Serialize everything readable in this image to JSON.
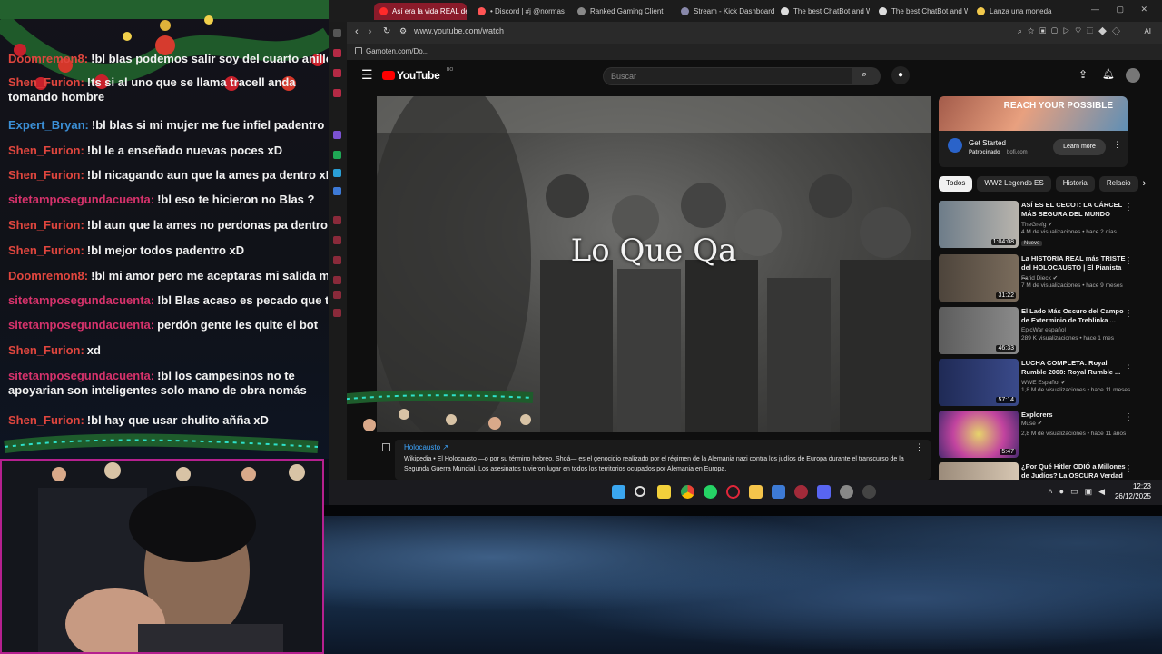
{
  "chat": {
    "messages": [
      {
        "user": "Doomremon8:",
        "user_color": "#e0463e",
        "text": "!bl blas podemos salir soy del cuarto anillo",
        "visible_user": "Doomremon8:"
      },
      {
        "user": "Shen_Furion:",
        "user_color": "#e0463e",
        "text": "!ts si al uno que se llama tracell anda tomando hombre"
      },
      {
        "user": "Expert_Bryan:",
        "user_color": "#3b8fd6",
        "text": "!bl blas si mi mujer me fue infiel padentro non"
      },
      {
        "user": "Shen_Furion:",
        "user_color": "#e0463e",
        "text": "!bl le a enseñado nuevas poces xD"
      },
      {
        "user": "Shen_Furion:",
        "user_color": "#e0463e",
        "text": "!bl nicagando aun que la ames pa dentro xD"
      },
      {
        "user": "sitetamposegundacuenta:",
        "user_color": "#d6326b",
        "text": "!bl eso te hicieron no Blas ?"
      },
      {
        "user": "Shen_Furion:",
        "user_color": "#e0463e",
        "text": "!bl aun que la ames no perdonas pa dentro xD"
      },
      {
        "user": "Shen_Furion:",
        "user_color": "#e0463e",
        "text": "!bl mejor todos padentro xD"
      },
      {
        "user": "Doomremon8:",
        "user_color": "#e0463e",
        "text": "!bl mi amor pero me aceptaras mi salida mi am"
      },
      {
        "user": "sitetamposegundacuenta:",
        "user_color": "#d6326b",
        "text": "!bl Blas acaso es pecado que te ar"
      },
      {
        "user": "sitetamposegundacuenta:",
        "user_color": "#d6326b",
        "text": "perdón gente les quite el bot"
      },
      {
        "user": "Shen_Furion:",
        "user_color": "#e0463e",
        "text": "xd"
      },
      {
        "user": "sitetamposegundacuenta:",
        "user_color": "#d6326b",
        "text": "!bl los campesinos no te apoyarian son inteligentes solo mano de obra nomás"
      },
      {
        "user": "Shen_Furion:",
        "user_color": "#e0463e",
        "text": "!bl hay que usar chulito añña xD"
      }
    ]
  },
  "browser": {
    "tabs": [
      {
        "label": "Así era la vida REAL de lo",
        "active": true,
        "color": "#ff2a2a"
      },
      {
        "label": "• Discord | #j @normas-",
        "color": "#ff5555"
      },
      {
        "label": "Ranked Gaming Client",
        "color": "#888888"
      },
      {
        "label": "Stream - Kick Dashboard",
        "color": "#8888aa"
      },
      {
        "label": "The best ChatBot and W",
        "color": "#dddddd"
      },
      {
        "label": "The best ChatBot and W",
        "color": "#dddddd"
      },
      {
        "label": "Lanza una moneda",
        "color": "#f2c94c"
      }
    ],
    "url": "www.youtube.com/watch",
    "bookmark": "Gamoten.com/Do...",
    "extension_label": "AI"
  },
  "youtube": {
    "logo": "YouTube",
    "logo_sup": "BO",
    "search_placeholder": "Buscar",
    "video_overlay_text": "Lo Que Qa",
    "wiki": {
      "title": "Holocausto ↗",
      "text": "Wikipedia • El Holocausto —o por su término hebreo, Shoá— es el genocidio realizado por el régimen de la Alemania nazi contra los judíos de Europa durante el transcurso de la Segunda Guerra Mundial. Los asesinatos tuvieron lugar en todos los territorios ocupados por Alemania en Europa."
    },
    "ad": {
      "banner": "REACH YOUR POSSIBLE",
      "title": "Get Started",
      "sponsor": "Patrocinado",
      "domain": "bofi.com",
      "cta": "Learn more"
    },
    "chips": [
      "Todos",
      "WW2 Legends ES",
      "Historia",
      "Relacio"
    ],
    "recommendations": [
      {
        "title": "ASÍ ES EL CECOT: LA CÁRCEL MÁS SEGURA DEL MUNDO",
        "channel": "TheGrefg ✔",
        "meta": "4 M de visualizaciones • hace 2 días",
        "badge": "Nuevo",
        "duration": "1:04:08",
        "thumb": "#7a8c9a"
      },
      {
        "title": "La HISTORIA REAL más TRISTE del HOLOCAUSTO | El Pianista ...",
        "channel": "Farid Dieck ✔",
        "meta": "7 M de visualizaciones • hace 9 meses",
        "duration": "31:22",
        "thumb": "#5a5046"
      },
      {
        "title": "El Lado Más Oscuro del Campo de Exterminio de Treblinka ...",
        "channel": "EpicWar español",
        "meta": "289 K visualizaciones • hace 1 mes",
        "duration": "46:33",
        "thumb": "#6b6b6b"
      },
      {
        "title": "LUCHA COMPLETA: Royal Rumble 2008: Royal Rumble ...",
        "channel": "WWE Español ✔",
        "meta": "1,8 M de visualizaciones • hace 11 meses",
        "duration": "57:14",
        "thumb": "#2b3a6a"
      },
      {
        "title": "Explorers",
        "channel": "Muse ✔",
        "meta": "2,8 M de visualizaciones • hace 11 años",
        "duration": "5:47",
        "thumb": "#b3439c"
      },
      {
        "title": "¿Por Qué Hitler ODIÓ a Millones de Judíos? La OSCURA Verdad",
        "channel": "",
        "meta": "",
        "duration": "",
        "thumb": "#9b8b7a"
      }
    ]
  },
  "taskbar": {
    "time": "12:23",
    "date": "26/12/2025"
  }
}
